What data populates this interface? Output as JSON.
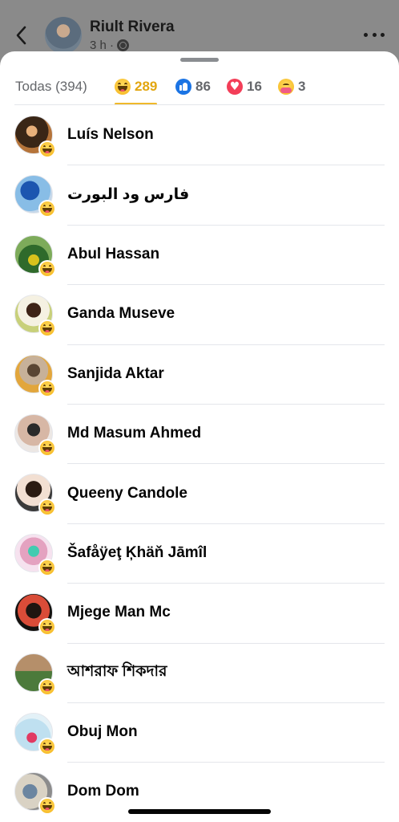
{
  "post": {
    "author": "Riult Rivera",
    "time": "3 h ·"
  },
  "tabs": {
    "all": "Todas (394)",
    "haha": "289",
    "like": "86",
    "love": "16",
    "care": "3",
    "active": "haha"
  },
  "people": [
    {
      "name": "Luís Nelson",
      "reaction": "haha"
    },
    {
      "name": "فارس ود البورت",
      "reaction": "haha"
    },
    {
      "name": "Abul Hassan",
      "reaction": "haha"
    },
    {
      "name": "Ganda Museve",
      "reaction": "haha"
    },
    {
      "name": "Sanjida Aktar",
      "reaction": "haha"
    },
    {
      "name": "Md Masum Ahmed",
      "reaction": "haha"
    },
    {
      "name": "Queeny Candole",
      "reaction": "haha"
    },
    {
      "name": "Šafåÿeţ Ķhäň Jāmîl",
      "reaction": "haha"
    },
    {
      "name": "Mjege Man Mc",
      "reaction": "haha"
    },
    {
      "name": "আশরাফ শিকদার",
      "reaction": "haha"
    },
    {
      "name": "Obuj Mon",
      "reaction": "haha"
    },
    {
      "name": "Dom Dom",
      "reaction": "haha"
    }
  ],
  "colors": {
    "active_tab": "#e2a610",
    "like_blue": "#1b74e4",
    "love_red": "#f33e58"
  }
}
